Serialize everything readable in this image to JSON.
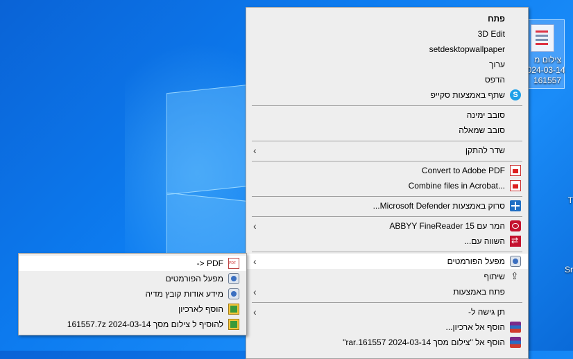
{
  "desktop": {
    "icon_label_lines": [
      "צילום מ",
      "2024-03-14",
      "161557"
    ],
    "edge_text_1": "T",
    "edge_text_2": "Sr"
  },
  "main_menu": {
    "items": [
      {
        "label": "פתח",
        "bold": true
      },
      {
        "label": "3D Edit"
      },
      {
        "label": "setdesktopwallpaper"
      },
      {
        "label": "ערוך"
      },
      {
        "label": "הדפס"
      },
      {
        "label": "שתף באמצעות סקייפ",
        "icon": "skype-icon"
      },
      {
        "label": "סובב ימינה"
      },
      {
        "label": "סובב שמאלה"
      },
      {
        "label": "שדר להתקן",
        "submenu": true
      },
      {
        "label": "Convert to Adobe PDF",
        "icon": "adobe-pdf-icon"
      },
      {
        "label": "Combine files in Acrobat...",
        "icon": "acrobat-combine-icon"
      },
      {
        "label": "סרוק באמצעות Microsoft Defender...",
        "icon": "defender-icon"
      },
      {
        "label": "המר עם ABBYY FineReader 15",
        "icon": "abbyy-icon",
        "submenu": true
      },
      {
        "label": "השווה עם...",
        "icon": "compare-icon"
      },
      {
        "label": "מפעל הפורמטים",
        "icon": "format-factory-icon",
        "submenu": true,
        "highlighted": true
      },
      {
        "label": "שיתוף",
        "icon": "share-icon"
      },
      {
        "label": "פתח באמצעות",
        "submenu": true
      },
      {
        "label": "תן גישה ל-",
        "submenu": true
      },
      {
        "label": "הוסף אל ארכיון...",
        "icon": "winrar-icon"
      },
      {
        "label": "הוסף אל \"צילום מסך 2024-03-14 161557.rar\"",
        "icon": "winrar-icon"
      }
    ]
  },
  "sub_menu": {
    "items": [
      {
        "label": "-> PDF",
        "icon": "pdf-icon",
        "highlighted": true
      },
      {
        "label": "מפעל הפורמטים",
        "icon": "format-factory-icon"
      },
      {
        "label": "מידע אודות קובץ מדיה",
        "icon": "format-factory-icon"
      },
      {
        "label": "הוסף לארכיון",
        "icon": "7zip-icon"
      },
      {
        "label": "להוסיף ל צילום מסך 2024-03-14 161557.7z",
        "icon": "7zip-icon"
      }
    ]
  },
  "colors": {
    "desktop_bg": "#0d7cf0",
    "menu_bg": "#eeeeee",
    "menu_highlight": "#ffffff",
    "separator": "#a0a0a0"
  }
}
